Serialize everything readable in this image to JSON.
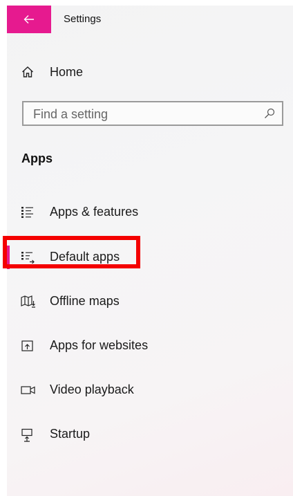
{
  "window": {
    "title": "Settings"
  },
  "titlebar": {
    "back_icon": "back-arrow-icon",
    "accent_color": "#e61a8f"
  },
  "home": {
    "label": "Home",
    "icon": "home-icon"
  },
  "search": {
    "placeholder": "Find a setting",
    "value": "",
    "icon": "search-icon"
  },
  "section": {
    "title": "Apps"
  },
  "nav": {
    "items": [
      {
        "label": "Apps & features",
        "icon": "apps-features-icon",
        "selected": false
      },
      {
        "label": "Default apps",
        "icon": "default-apps-icon",
        "selected": true
      },
      {
        "label": "Offline maps",
        "icon": "offline-maps-icon",
        "selected": false
      },
      {
        "label": "Apps for websites",
        "icon": "apps-for-websites-icon",
        "selected": false
      },
      {
        "label": "Video playback",
        "icon": "video-playback-icon",
        "selected": false
      },
      {
        "label": "Startup",
        "icon": "startup-icon",
        "selected": false
      }
    ]
  },
  "annotation": {
    "color": "#f40000",
    "target": "Default apps"
  }
}
